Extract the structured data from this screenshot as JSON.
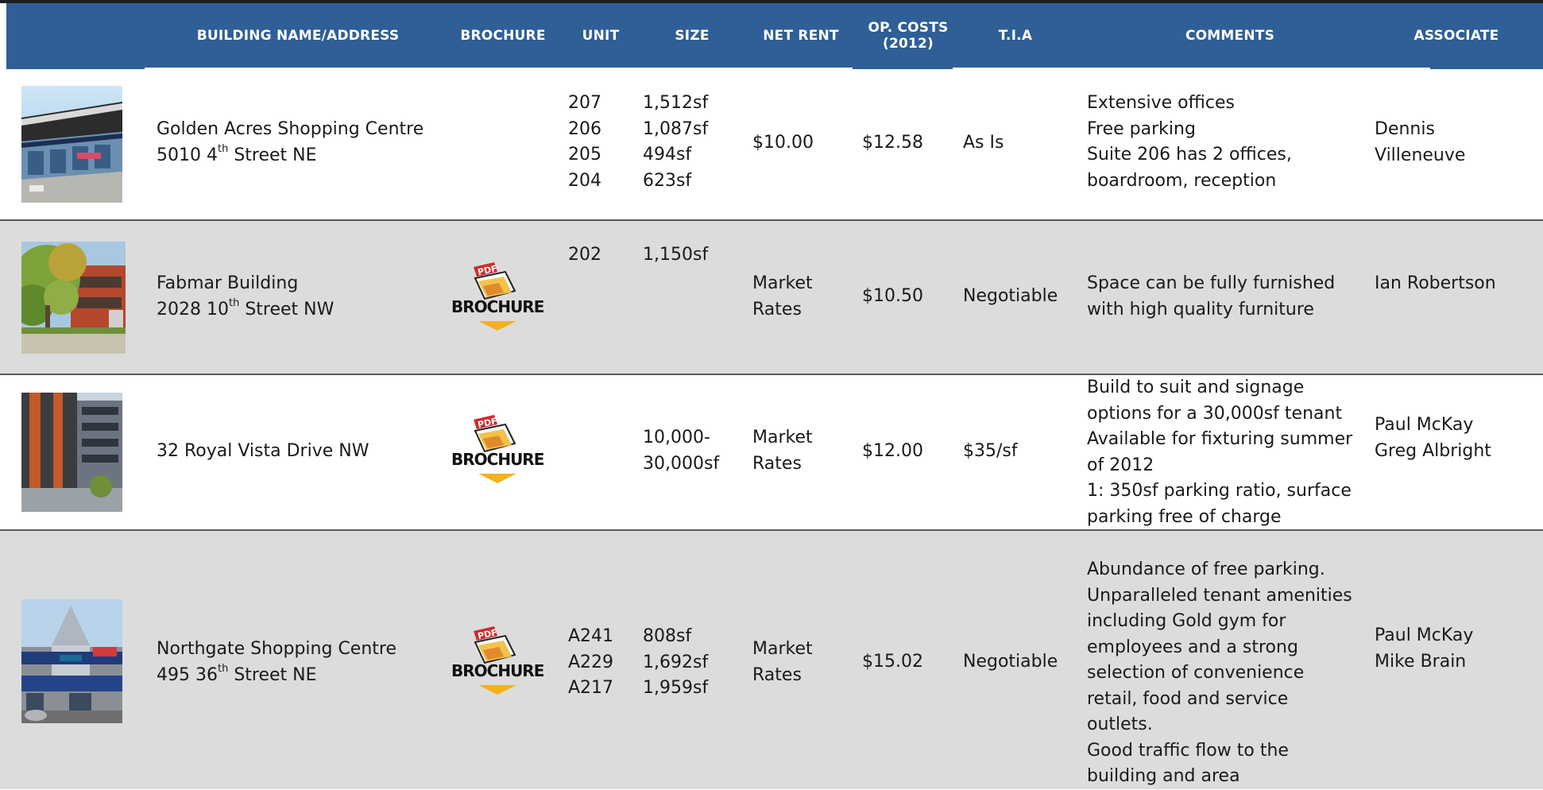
{
  "header": {
    "building": "BUILDING NAME/ADDRESS",
    "brochure": "BROCHURE",
    "unit": "UNIT",
    "size": "SIZE",
    "net_rent": "NET RENT",
    "op_costs_line1": "OP. COSTS",
    "op_costs_line2": "(2012)",
    "tia": "T.I.A",
    "comments": "COMMENTS",
    "associate": "ASSOCIATE"
  },
  "colors": {
    "header_bg": "#2f5f96",
    "header_text": "#ffffff",
    "row_shaded": "#dcdcdc",
    "brochure_pdf_red": "#d62828",
    "brochure_arrow": "#f2b21b"
  },
  "brochure_label": "BROCHURE",
  "pdf_label": "PDF",
  "listings": [
    {
      "name": "Golden Acres Shopping Centre",
      "addr_num": "5010 4",
      "addr_sup": "th",
      "addr_street": " Street NE",
      "units": [
        "207",
        "206",
        "205",
        "204"
      ],
      "sizes": [
        "1,512sf",
        "1,087sf",
        "494sf",
        "623sf"
      ],
      "net_rent": [
        "$10.00"
      ],
      "op_costs": "$12.58",
      "tia": "As Is",
      "comments": [
        "Extensive offices",
        "Free parking",
        "Suite 206 has 2 offices,",
        "boardroom, reception"
      ],
      "associate": [
        "Dennis",
        "Villeneuve"
      ],
      "has_brochure": false
    },
    {
      "name": "Fabmar Building",
      "addr_num": "2028 10",
      "addr_sup": "th",
      "addr_street": " Street NW",
      "units": [
        "202"
      ],
      "sizes": [
        "1,150sf"
      ],
      "net_rent": [
        "Market",
        "Rates"
      ],
      "op_costs": "$10.50",
      "tia": "Negotiable",
      "comments": [
        "Space can be fully furnished",
        "with high quality furniture"
      ],
      "associate": [
        "Ian Robertson"
      ],
      "has_brochure": true
    },
    {
      "name": "32 Royal Vista Drive NW",
      "units": [],
      "sizes": [
        "10,000-",
        "30,000sf"
      ],
      "net_rent": [
        "Market",
        "Rates"
      ],
      "op_costs": "$12.00",
      "tia": "$35/sf",
      "comments": [
        "Build to suit and signage",
        "options for a 30,000sf tenant",
        "Available for fixturing summer",
        "of 2012",
        "1: 350sf parking ratio, surface",
        "parking free of charge"
      ],
      "associate": [
        "Paul McKay",
        "Greg Albright"
      ],
      "has_brochure": true
    },
    {
      "name": "Northgate Shopping Centre",
      "addr_num": "495 36",
      "addr_sup": "th",
      "addr_street": " Street NE",
      "units": [
        "A241",
        "A229",
        "A217"
      ],
      "sizes": [
        "808sf",
        "1,692sf",
        "1,959sf"
      ],
      "net_rent": [
        "Market",
        "Rates"
      ],
      "op_costs": "$15.02",
      "tia": "Negotiable",
      "comments": [
        "Abundance of free parking.",
        "Unparalleled tenant amenities",
        "including Gold gym for",
        "employees and a strong",
        "selection of convenience",
        "retail, food and service",
        "outlets.",
        "Good traffic flow to the",
        "building and area"
      ],
      "associate": [
        "Paul McKay",
        "Mike Brain"
      ],
      "has_brochure": true
    }
  ]
}
